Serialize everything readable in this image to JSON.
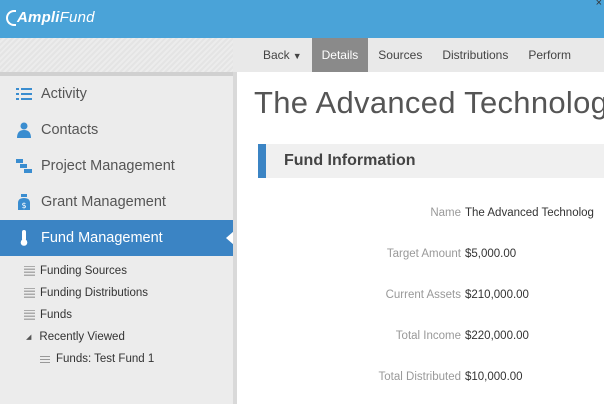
{
  "app": {
    "logo_bold": "Ampli",
    "logo_rest": "Fund",
    "close_glyph": "×"
  },
  "tabs": [
    {
      "label": "Back",
      "has_caret": true
    },
    {
      "label": "Details",
      "active": true
    },
    {
      "label": "Sources"
    },
    {
      "label": "Distributions"
    },
    {
      "label": "Perform"
    }
  ],
  "sidebar": {
    "items": [
      {
        "label": "Activity",
        "icon": "list-icon"
      },
      {
        "label": "Contacts",
        "icon": "person-icon"
      },
      {
        "label": "Project Management",
        "icon": "project-icon"
      },
      {
        "label": "Grant Management",
        "icon": "money-bag-icon"
      },
      {
        "label": "Fund Management",
        "icon": "thermometer-icon",
        "active": true
      }
    ],
    "sub_items": [
      {
        "label": "Funding Sources"
      },
      {
        "label": "Funding Distributions"
      },
      {
        "label": "Funds"
      }
    ],
    "recently_viewed": {
      "label": "Recently Viewed",
      "items": [
        {
          "label": "Funds: Test Fund 1"
        }
      ]
    }
  },
  "main": {
    "title": "The Advanced Technolog",
    "section_title": "Fund Information",
    "fields": [
      {
        "label": "Name",
        "value": "The Advanced Technolog"
      },
      {
        "label": "Target Amount",
        "value": "$5,000.00"
      },
      {
        "label": "Current Assets",
        "value": "$210,000.00"
      },
      {
        "label": "Total Income",
        "value": "$220,000.00"
      },
      {
        "label": "Total Distributed",
        "value": "$10,000.00"
      }
    ]
  },
  "colors": {
    "topbar": "#4aa3d8",
    "accent": "#3b84c4",
    "active_tab": "#8a8a8a"
  }
}
